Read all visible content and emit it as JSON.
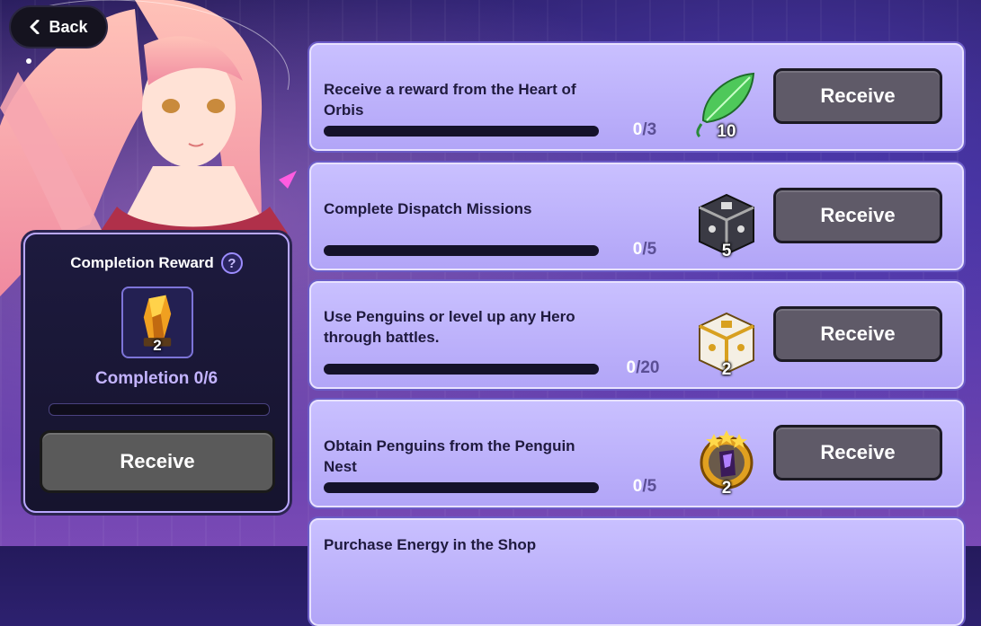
{
  "nav": {
    "back_label": "Back"
  },
  "completion": {
    "title": "Completion Reward",
    "help_symbol": "?",
    "reward_count": "2",
    "progress_text": "Completion  0/6",
    "progress_fraction": 0,
    "receive_label": "Receive"
  },
  "missions": [
    {
      "description": "Receive a reward from the Heart of Orbis",
      "current": "0",
      "total": "/3",
      "progress_fraction": 0,
      "reward_icon": "leaf-icon",
      "reward_qty": "10",
      "receive_label": "Receive"
    },
    {
      "description": "Complete Dispatch Missions",
      "current": "0",
      "total": "/5",
      "progress_fraction": 0,
      "reward_icon": "silver-chest-icon",
      "reward_qty": "5",
      "receive_label": "Receive"
    },
    {
      "description": "Use Penguins or level up any Hero through battles.",
      "current": "0",
      "total": "/20",
      "progress_fraction": 0,
      "reward_icon": "gold-chest-icon",
      "reward_qty": "2",
      "receive_label": "Receive"
    },
    {
      "description": "Obtain Penguins from the Penguin Nest",
      "current": "0",
      "total": "/5",
      "progress_fraction": 0,
      "reward_icon": "penguin-medal-icon",
      "reward_qty": "2",
      "receive_label": "Receive"
    },
    {
      "description": "Purchase Energy in the Shop"
    }
  ],
  "colors": {
    "card": "#c0b5fb",
    "receive_button": "#5f5a68",
    "panel_border": "#b9a8ff"
  }
}
